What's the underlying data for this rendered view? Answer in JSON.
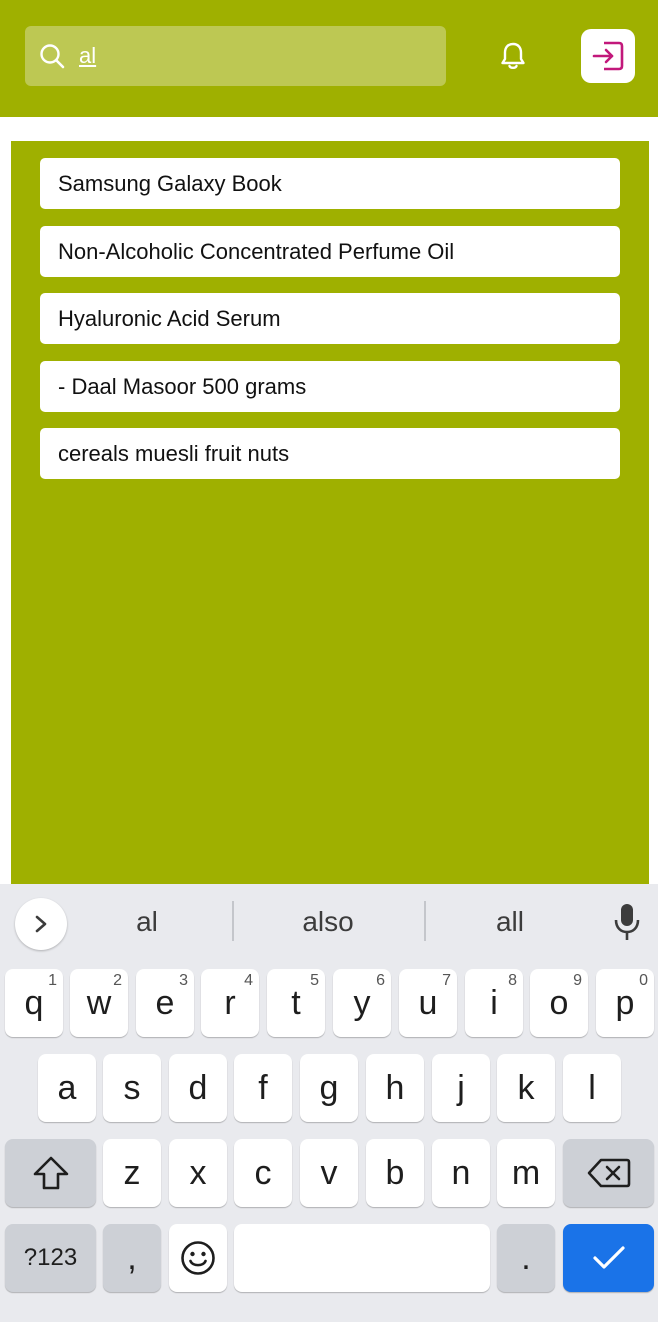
{
  "header": {
    "search_value": "al",
    "search_icon": "search-icon",
    "bell_icon": "bell-icon",
    "login_icon": "login-icon",
    "colors": {
      "bar": "#9fb000",
      "accent": "#c2187b"
    }
  },
  "results": [
    "Samsung Galaxy Book",
    "Non-Alcoholic Concentrated Perfume Oil",
    "Hyaluronic Acid Serum",
    "- Daal Masoor 500 grams",
    "cereals muesli fruit nuts"
  ],
  "keyboard": {
    "suggestions": [
      "al",
      "also",
      "all"
    ],
    "row1": [
      {
        "key": "q",
        "hint": "1"
      },
      {
        "key": "w",
        "hint": "2"
      },
      {
        "key": "e",
        "hint": "3"
      },
      {
        "key": "r",
        "hint": "4"
      },
      {
        "key": "t",
        "hint": "5"
      },
      {
        "key": "y",
        "hint": "6"
      },
      {
        "key": "u",
        "hint": "7"
      },
      {
        "key": "i",
        "hint": "8"
      },
      {
        "key": "o",
        "hint": "9"
      },
      {
        "key": "p",
        "hint": "0"
      }
    ],
    "row2": [
      "a",
      "s",
      "d",
      "f",
      "g",
      "h",
      "j",
      "k",
      "l"
    ],
    "row3": [
      "z",
      "x",
      "c",
      "v",
      "b",
      "n",
      "m"
    ],
    "symbols_label": "?123",
    "comma_label": ",",
    "period_label": "."
  }
}
